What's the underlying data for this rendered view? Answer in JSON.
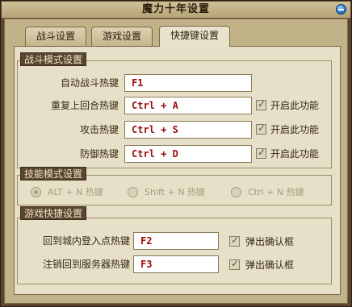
{
  "window": {
    "title": "魔力十年设置"
  },
  "tabs": [
    {
      "label": "战斗设置"
    },
    {
      "label": "游戏设置"
    },
    {
      "label": "快捷键设置"
    }
  ],
  "combat_section": {
    "title": "战斗模式设置",
    "rows": [
      {
        "label": "自动战斗热键",
        "value": "F1"
      },
      {
        "label": "重复上回合热键",
        "value": "Ctrl + A",
        "check_label": "开启此功能",
        "checked": true
      },
      {
        "label": "攻击热键",
        "value": "Ctrl + S",
        "check_label": "开启此功能",
        "checked": true
      },
      {
        "label": "防御热键",
        "value": "Ctrl + D",
        "check_label": "开启此功能",
        "checked": true
      }
    ]
  },
  "skill_section": {
    "title": "技能模式设置",
    "options": [
      {
        "label": "ALT + N  热键",
        "selected": true
      },
      {
        "label": "Shift + N  热键",
        "selected": false
      },
      {
        "label": "Ctrl + N  热键",
        "selected": false
      }
    ]
  },
  "game_section": {
    "title": "游戏快捷设置",
    "rows": [
      {
        "label": "回到城内登入点热键",
        "value": "F2",
        "check_label": "弹出确认框",
        "checked": true
      },
      {
        "label": "注销回到服务器热键",
        "value": "F3",
        "check_label": "弹出确认框",
        "checked": true
      }
    ]
  },
  "colors": {
    "frame": "#5a4630",
    "panel": "#e6e0c8",
    "hotkey_text": "#9e0a0a",
    "accent_blue": "#1b64c8"
  }
}
